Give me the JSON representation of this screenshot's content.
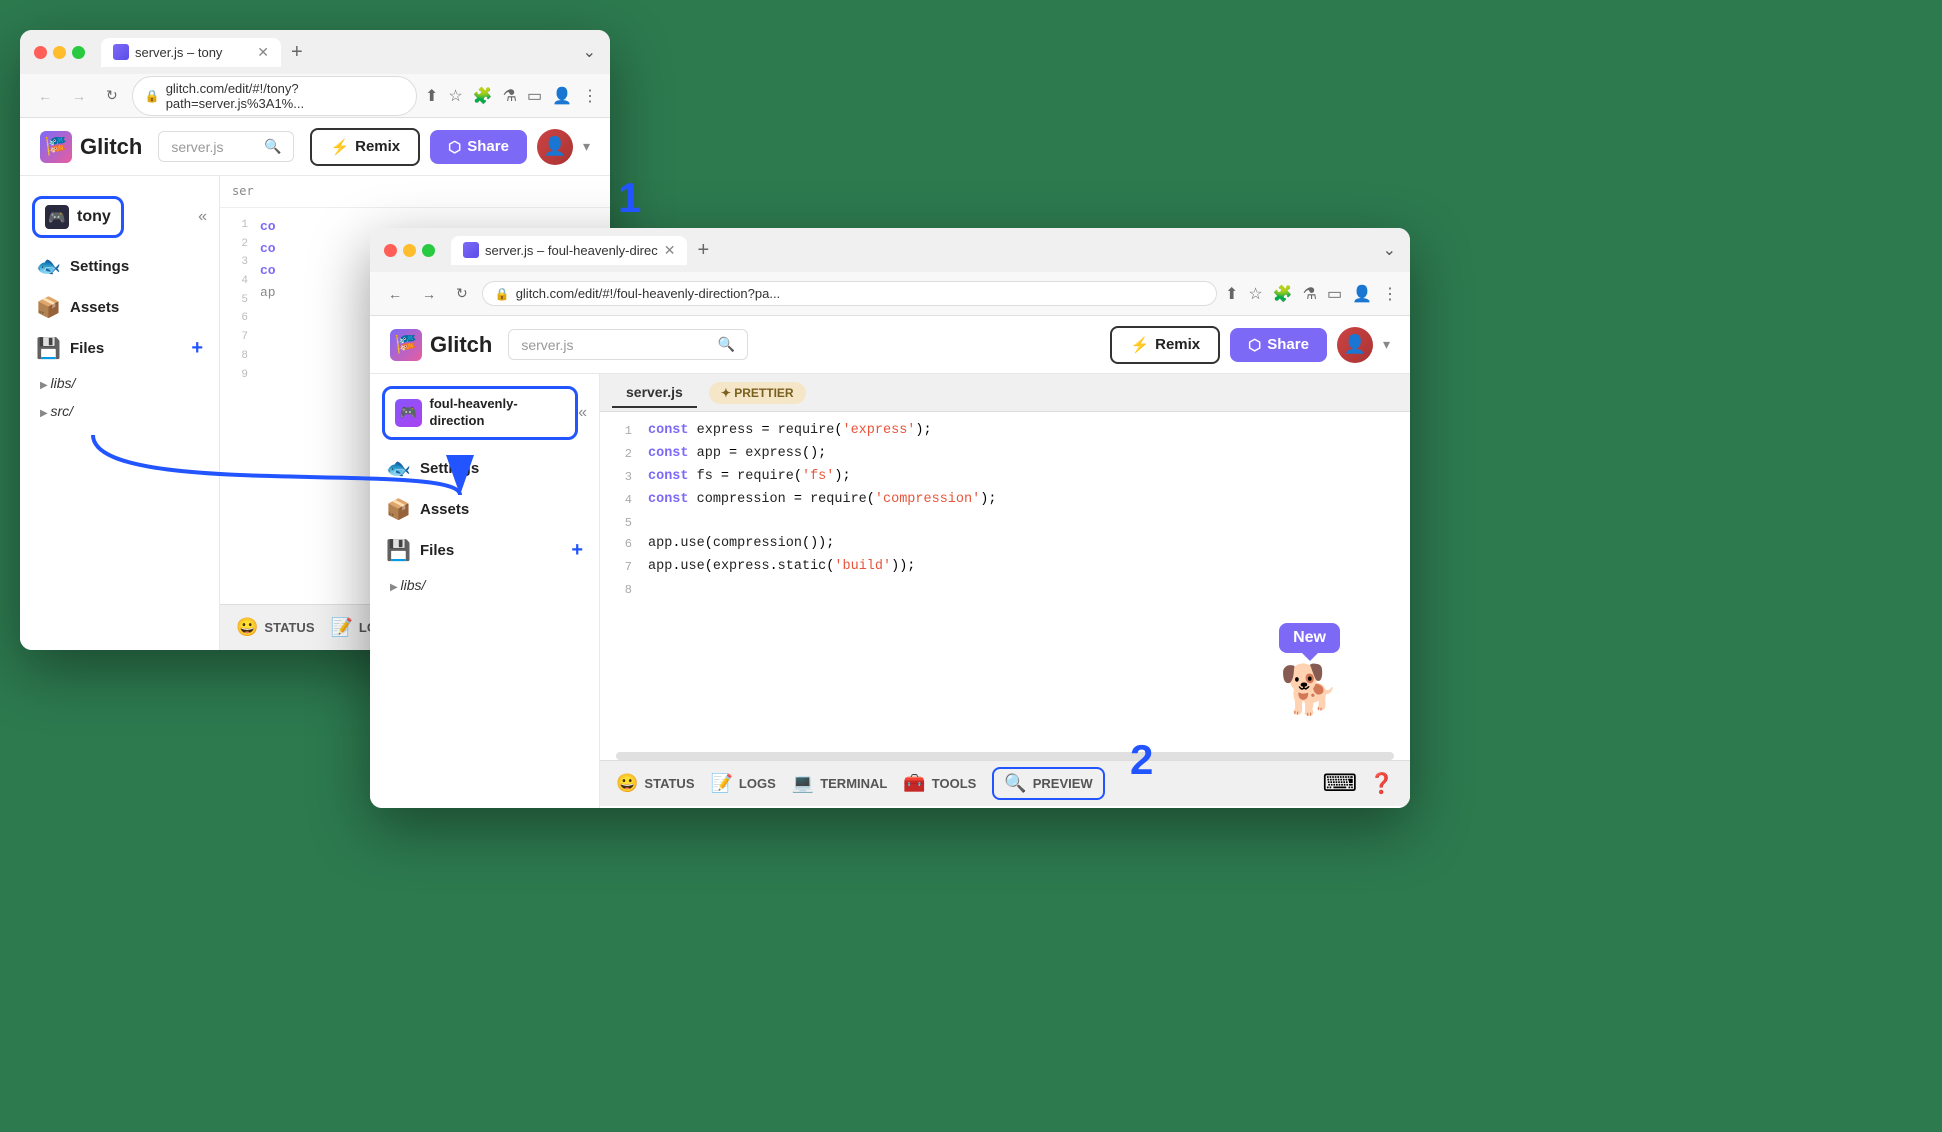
{
  "background_color": "#3d8b5e",
  "window_back": {
    "title": "server.js – tony",
    "tab_label": "server.js – tony",
    "address": "glitch.com/edit/#!/tony?path=server.js%3A1%...",
    "project_name": "tony",
    "search_placeholder": "server.js",
    "btn_remix": "Remix",
    "btn_share": "Share",
    "sidebar": {
      "settings": "Settings",
      "assets": "Assets",
      "files": "Files",
      "folders": [
        "libs/",
        "src/"
      ]
    },
    "status_bar": {
      "status": "STATUS",
      "logs": "LOGS"
    }
  },
  "window_front": {
    "title": "server.js – foul-heavenly-direc",
    "tab_label": "server.js – foul-heavenly-direc",
    "address": "glitch.com/edit/#!/foul-heavenly-direction?pa...",
    "project_name": "foul-heavenly-direction",
    "search_placeholder": "server.js",
    "btn_remix": "Remix",
    "btn_share": "Share",
    "file_tab": "server.js",
    "prettier_btn": "✦ PRETTIER",
    "code_lines": [
      {
        "num": "1",
        "content": "const express = require('express');"
      },
      {
        "num": "2",
        "content": "const app = express();"
      },
      {
        "num": "3",
        "content": "const fs = require('fs');"
      },
      {
        "num": "4",
        "content": "const compression = require('compression');"
      },
      {
        "num": "5",
        "content": ""
      },
      {
        "num": "6",
        "content": "app.use(compression());"
      },
      {
        "num": "7",
        "content": "app.use(express.static('build'));"
      },
      {
        "num": "8",
        "content": ""
      }
    ],
    "status_bar": {
      "status": "STATUS",
      "logs": "LOGS",
      "terminal": "TERMINAL",
      "tools": "TOOLS",
      "preview": "PREVIEW"
    },
    "new_label": "New"
  },
  "number_badge_1": "1",
  "number_badge_2": "2",
  "icons": {
    "glitch": "🎏",
    "settings": "🐟",
    "assets": "📦",
    "files": "💾",
    "status": "😀",
    "logs": "📝",
    "terminal": "💻",
    "tools": "🧰",
    "preview": "🔍",
    "remix": "⚡",
    "share": "⬡",
    "puzzle": "🧩",
    "flask": "⚗",
    "sidebar_icon": "⊞",
    "person": "👤",
    "keyboard": "⌨"
  }
}
